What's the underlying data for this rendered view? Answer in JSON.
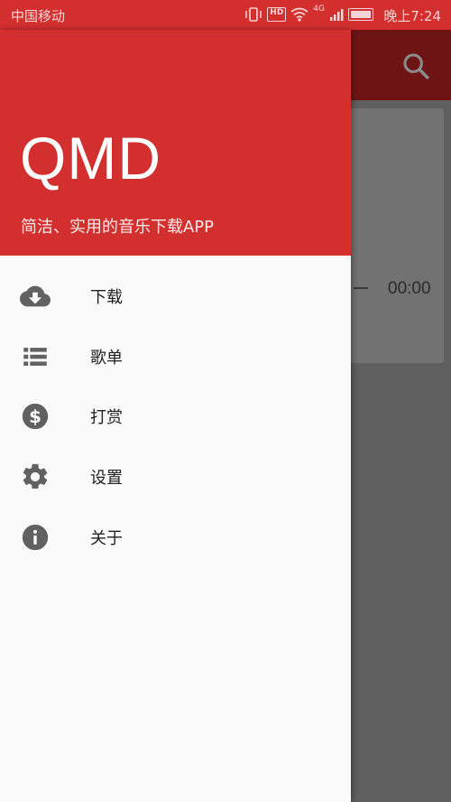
{
  "status_bar": {
    "carrier": "中国移动",
    "hd_badge": "HD",
    "network": "4G",
    "time": "晚上7:24"
  },
  "background": {
    "player_time": "00:00"
  },
  "drawer": {
    "app_name": "QMD",
    "tagline": "简洁、实用的音乐下载APP",
    "items": [
      {
        "label": "下载",
        "icon": "cloud-download-icon"
      },
      {
        "label": "歌单",
        "icon": "playlist-icon"
      },
      {
        "label": "打赏",
        "icon": "dollar-icon"
      },
      {
        "label": "设置",
        "icon": "gear-icon"
      },
      {
        "label": "关于",
        "icon": "info-icon"
      }
    ]
  },
  "colors": {
    "accent": "#d32f2f",
    "icon": "#616161"
  }
}
